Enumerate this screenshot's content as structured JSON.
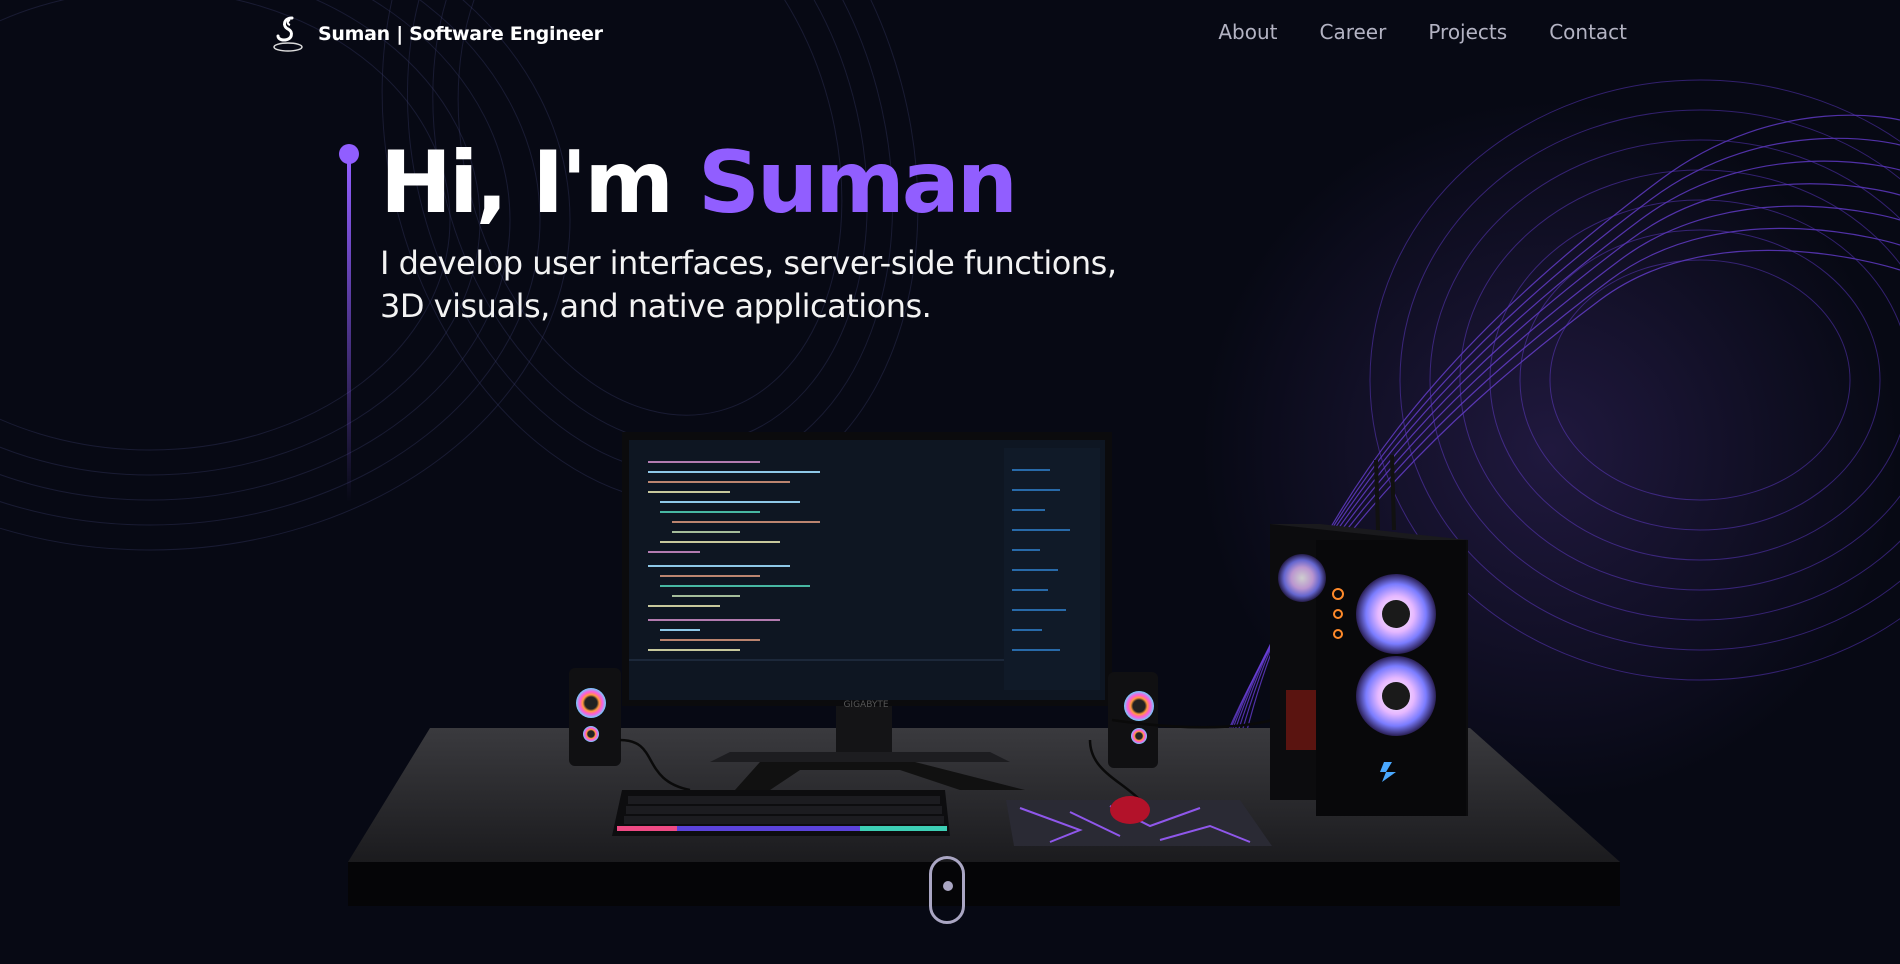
{
  "nav": {
    "brand_name": "Suman",
    "brand_tagline": "| Software Engineer",
    "links": [
      "About",
      "Career",
      "Projects",
      "Contact"
    ]
  },
  "hero": {
    "greeting": "Hi, I'm",
    "name": "Suman",
    "subtitle_line1": "I develop user interfaces, server-side functions,",
    "subtitle_line2": "3D visuals, and native applications."
  },
  "scene": {
    "monitor_brand": "GIGABYTE"
  },
  "colors": {
    "background": "#070914",
    "accent": "#915eff",
    "nav_text": "#b3b3c3"
  },
  "icons": {
    "logo": "swan-s-logo-icon",
    "scroll": "mouse-scroll-icon"
  }
}
